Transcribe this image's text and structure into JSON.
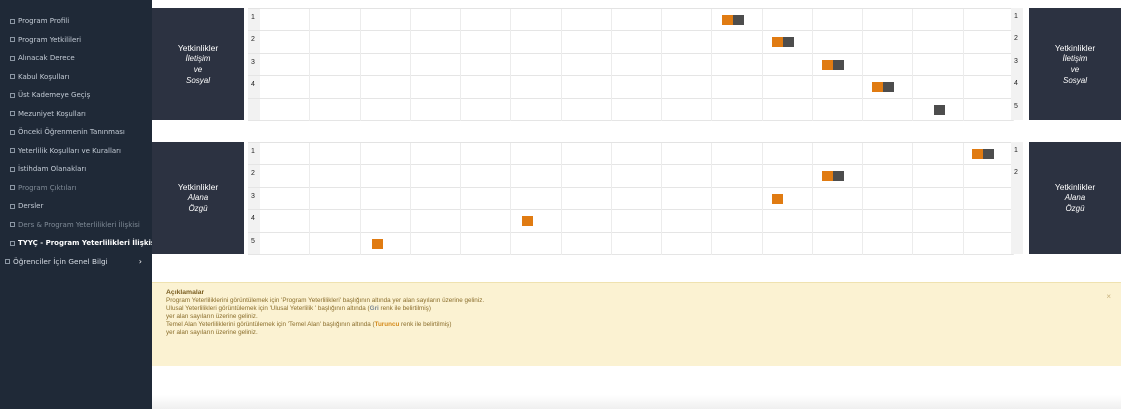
{
  "sidebar": {
    "items": [
      {
        "label": "Program Profili"
      },
      {
        "label": "Program Yetkilileri"
      },
      {
        "label": "Alınacak Derece"
      },
      {
        "label": "Kabul Koşulları"
      },
      {
        "label": "Üst Kademeye Geçiş"
      },
      {
        "label": "Mezuniyet Koşulları"
      },
      {
        "label": "Önceki Öğrenmenin Tanınması"
      },
      {
        "label": "Yeterlilik Koşulları ve Kuralları"
      },
      {
        "label": "İstihdam Olanakları"
      },
      {
        "label": "Program Çıktıları"
      },
      {
        "label": "Dersler"
      },
      {
        "label": "Ders & Program Yeterlilikleri İlişkisi"
      },
      {
        "label": "TYYÇ - Program Yeterlilikleri İlişkisi"
      }
    ],
    "group_label": "Öğrenciler İçin Genel Bilgi",
    "group_chevron": "›"
  },
  "colors": {
    "orange": "#e07b12",
    "gray": "#4d4d4d"
  },
  "competence_top": {
    "title": "Yetkinlikler",
    "subtitle": [
      "İletişim",
      "ve",
      "Sosyal"
    ],
    "left_rows": [
      "1",
      "2",
      "3",
      "4",
      ""
    ],
    "right_rows": [
      "1",
      "2",
      "3",
      "4",
      "5"
    ]
  },
  "competence_bottom": {
    "title": "Yetkinlikler",
    "subtitle": [
      "Alana",
      "Özgü"
    ],
    "left_rows": [
      "1",
      "2",
      "3",
      "4",
      "5"
    ],
    "right_rows": [
      "1",
      "2"
    ]
  },
  "notice": {
    "heading": "Açıklamalar",
    "line1": "Program Yeterliliklerini görüntülemek için 'Program Yeterlilikleri' başlığının altında yer alan sayıların üzerine geliniz.",
    "line2a": "Ulusal Yeterlilikleri görüntülemek için 'Ulusal Yeterlilik ' başlığının altında (",
    "line2_gri": "Gri",
    "line2b": " renk ile belirtilmiş)",
    "line3": "yer alan sayıların üzerine geliniz.",
    "line4a": "Temel Alan Yeterliliklerini görüntülemek için 'Temel Alan' başlığının altında (",
    "line4_tur": "Turuncu",
    "line4b": " renk ile belirtilmiş)",
    "line5": "yer alan sayıların üzerine geliniz.",
    "close": "×"
  }
}
